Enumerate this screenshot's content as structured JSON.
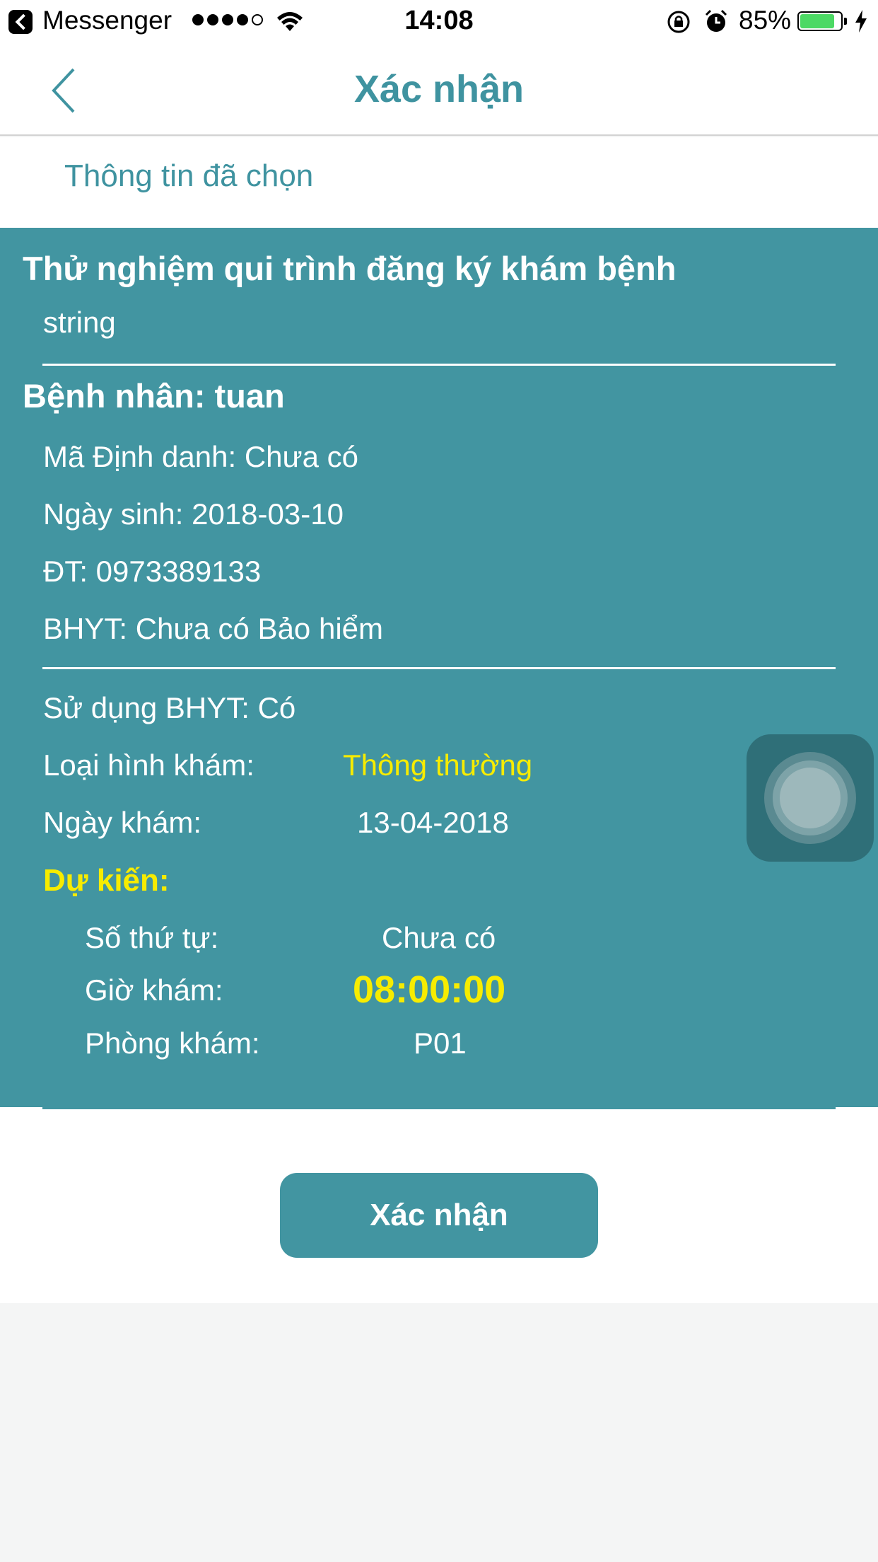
{
  "status_bar": {
    "back_app": "Messenger",
    "time": "14:08",
    "battery": "85%",
    "battery_level": 0.85,
    "icons": [
      "back-arrow-icon",
      "signal-icon",
      "wifi-icon",
      "rotation-lock-icon",
      "alarm-icon",
      "battery-icon",
      "charging-icon"
    ]
  },
  "nav": {
    "title": "Xác nhận",
    "back_icon": "chevron-left-icon"
  },
  "section": {
    "title": "Thông tin đã chọn"
  },
  "card": {
    "hospital_name": "Thử nghiệm qui trình đăng ký khám bệnh",
    "hospital_sub": "string",
    "patient_title": "Bệnh nhân: tuan",
    "patient_rows": [
      "Mã Định danh: Chưa có",
      "Ngày sinh: 2018-03-10",
      "ĐT: 0973389133",
      "BHYT: Chưa có Bảo hiểm"
    ],
    "use_bhyt": "Sử dụng BHYT: Có",
    "exam_type_label": "Loại hình khám:",
    "exam_type_value": "Thông thường",
    "exam_date_label": "Ngày khám:",
    "exam_date_value": "13-04-2018",
    "estimate_title": "Dự kiến:",
    "queue_label": "Số thứ tự:",
    "queue_value": "Chưa có",
    "time_label": "Giờ khám:",
    "time_value": "08:00:00",
    "room_label": "Phòng khám:",
    "room_value": "P01"
  },
  "button": {
    "confirm": "Xác nhận"
  },
  "colors": {
    "accent": "#4295a1",
    "highlight": "#f7ec00",
    "title": "#3f93a0"
  }
}
